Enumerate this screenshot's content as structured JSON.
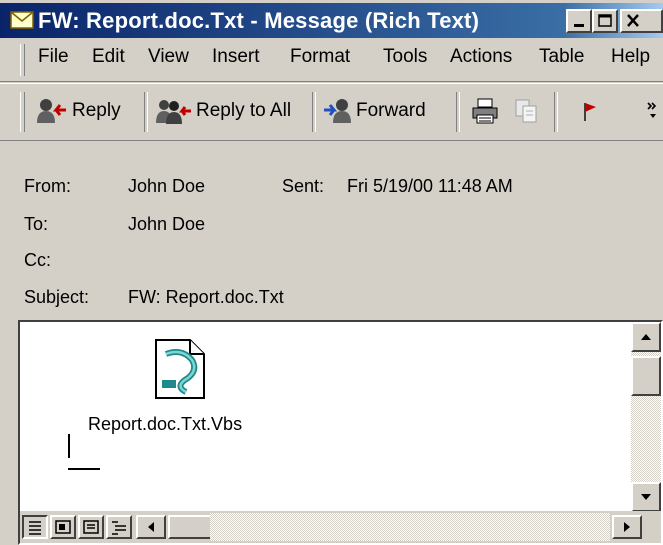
{
  "window": {
    "title": "FW: Report.doc.Txt - Message (Rich Text)",
    "icon": "envelope-icon",
    "controls": [
      "minimize-icon",
      "maximize-icon",
      "close-icon"
    ]
  },
  "menu": {
    "file": "File",
    "edit": "Edit",
    "view": "View",
    "insert": "Insert",
    "format": "Format",
    "tools": "Tools",
    "actions": "Actions",
    "table": "Table",
    "help": "Help"
  },
  "toolbar": {
    "reply": "Reply",
    "reply_all": "Reply to All",
    "forward": "Forward",
    "icons": [
      "print-icon",
      "copy-icon",
      "flag-icon",
      "more-chevron-icon"
    ]
  },
  "header": {
    "from_label": "From:",
    "from_value": "John Doe",
    "sent_label": "Sent:",
    "sent_value": "Fri 5/19/00 11:48 AM",
    "to_label": "To:",
    "to_value": "John Doe",
    "cc_label": "Cc:",
    "cc_value": "",
    "subject_label": "Subject:",
    "subject_value": "FW: Report.doc.Txt"
  },
  "body": {
    "attachment_name": "Report.doc.Txt.Vbs",
    "attachment_icon": "script-file-icon"
  },
  "colors": {
    "titlebar_start": "#0a246a",
    "titlebar_end": "#a6caf0",
    "face": "#d4d0c8",
    "flag": "#c00000"
  }
}
